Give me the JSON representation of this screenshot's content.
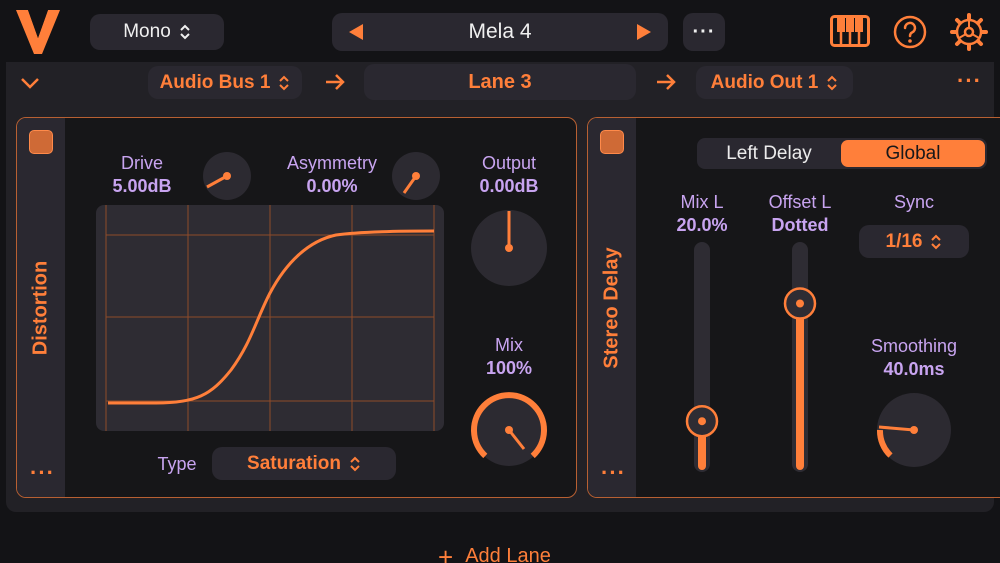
{
  "header": {
    "channel_mode": "Mono",
    "preset_name": "Mela 4",
    "more": "···"
  },
  "lane": {
    "input": "Audio Bus 1",
    "name": "Lane 3",
    "output": "Audio Out 1",
    "more": "···"
  },
  "distortion": {
    "title": "Distortion",
    "more": "···",
    "drive_label": "Drive",
    "drive_value": "5.00dB",
    "asymmetry_label": "Asymmetry",
    "asymmetry_value": "0.00%",
    "output_label": "Output",
    "output_value": "0.00dB",
    "mix_label": "Mix",
    "mix_value": "100%",
    "mix_level": 1.0,
    "type_label": "Type",
    "type_value": "Saturation"
  },
  "stereo_delay": {
    "title": "Stereo Delay",
    "more": "···",
    "tabs": [
      "Left Delay",
      "Global"
    ],
    "active_tab": "Global",
    "mix_label": "Mix L",
    "mix_value": "20.0%",
    "mix_level": 0.2,
    "offset_label": "Offset L",
    "offset_value": "Dotted",
    "offset_level": 0.75,
    "sync_label": "Sync",
    "sync_value": "1/16",
    "smoothing_label": "Smoothing",
    "smoothing_value": "40.0ms"
  },
  "footer": {
    "add_lane": "Add Lane"
  },
  "colors": {
    "accent": "#ff7f3a",
    "label": "#c8a4f0",
    "background": "#131316"
  }
}
